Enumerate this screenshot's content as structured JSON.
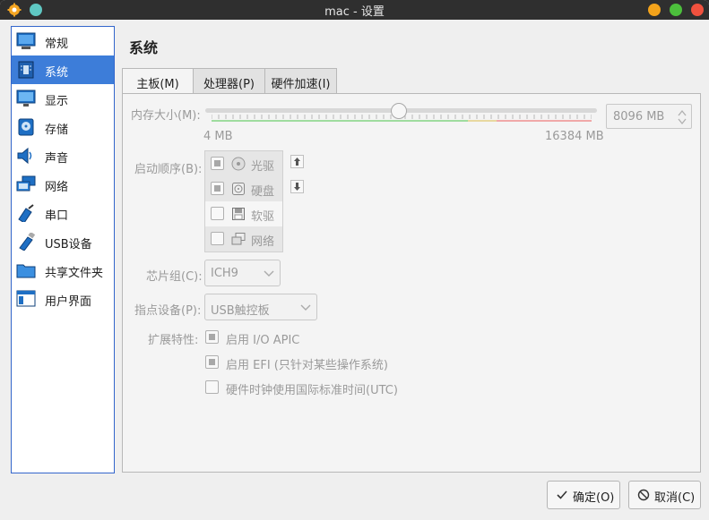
{
  "window": {
    "title": "mac - 设置"
  },
  "sidebar": {
    "items": [
      {
        "label": "常规",
        "icon": "general-icon"
      },
      {
        "label": "系统",
        "icon": "system-icon",
        "active": true
      },
      {
        "label": "显示",
        "icon": "display-icon"
      },
      {
        "label": "存储",
        "icon": "storage-icon"
      },
      {
        "label": "声音",
        "icon": "audio-icon"
      },
      {
        "label": "网络",
        "icon": "network-icon"
      },
      {
        "label": "串口",
        "icon": "serial-port-icon"
      },
      {
        "label": "USB设备",
        "icon": "usb-icon"
      },
      {
        "label": "共享文件夹",
        "icon": "shared-folder-icon"
      },
      {
        "label": "用户界面",
        "icon": "user-interface-icon"
      }
    ]
  },
  "page": {
    "title": "系统"
  },
  "tabs": [
    {
      "label": "主板(M)",
      "active": true
    },
    {
      "label": "处理器(P)"
    },
    {
      "label": "硬件加速(I)"
    }
  ],
  "memory": {
    "label": "内存大小(M):",
    "value": "8096 MB",
    "min_label": "4 MB",
    "max_label": "16384 MB",
    "min": 4,
    "max": 16384,
    "current": 8096
  },
  "boot_order": {
    "label": "启动顺序(B):",
    "items": [
      {
        "label": "光驱",
        "checked": true,
        "icon": "optical-drive-icon"
      },
      {
        "label": "硬盘",
        "checked": true,
        "icon": "hard-disk-icon"
      },
      {
        "label": "软驱",
        "checked": false,
        "icon": "floppy-icon"
      },
      {
        "label": "网络",
        "checked": false,
        "icon": "network-boot-icon"
      }
    ]
  },
  "chipset": {
    "label": "芯片组(C):",
    "value": "ICH9"
  },
  "pointing_device": {
    "label": "指点设备(P):",
    "value": "USB触控板"
  },
  "extended_features": {
    "label": "扩展特性:",
    "options": [
      {
        "label": "启用 I/O APIC",
        "checked": true
      },
      {
        "label": "启用 EFI (只针对某些操作系统)",
        "checked": true
      },
      {
        "label": "硬件时钟使用国际标准时间(UTC)",
        "checked": false
      }
    ]
  },
  "buttons": {
    "ok": "确定(O)",
    "cancel": "取消(C)"
  },
  "colors": {
    "accent": "#3d7dd9",
    "green_range": "#9fdc9f",
    "red_range": "#f0a8a8"
  }
}
